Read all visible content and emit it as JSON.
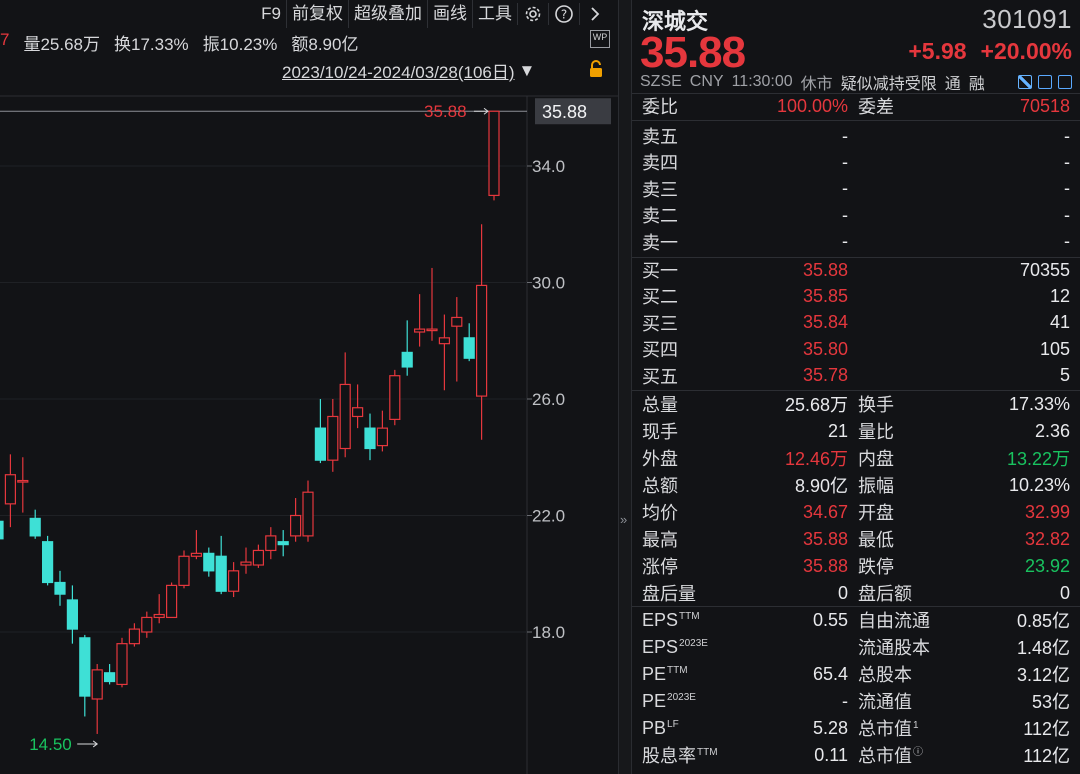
{
  "toolbar": {
    "items": [
      "F9",
      "前复权",
      "超级叠加",
      "画线",
      "工具"
    ],
    "icons": [
      "gear-icon",
      "help-icon",
      "chevron-right-icon"
    ]
  },
  "stats": {
    "cut_value": "7",
    "volume": "量25.68万",
    "turnover": "换17.33%",
    "amplitude": "振10.23%",
    "amount": "额8.90亿"
  },
  "wp_label": "WP",
  "range": {
    "text": "2023/10/24-2024/03/28(106日)",
    "arrow": "▼"
  },
  "chart_data": {
    "type": "candlestick",
    "y_ticks": [
      "34.0",
      "30.0",
      "26.0",
      "22.0",
      "18.0"
    ],
    "ylim": [
      14.0,
      36.0
    ],
    "current_price_label": "35.88",
    "high_annotation": "35.88",
    "low_annotation": "14.50",
    "up_color": "#e5373d",
    "down_color": "#3ee0d6",
    "candles": [
      {
        "o": 21.8,
        "c": 21.2,
        "h": 23.8,
        "l": 20.0
      },
      {
        "o": 22.4,
        "c": 23.4,
        "h": 24.1,
        "l": 21.6
      },
      {
        "o": 23.2,
        "c": 23.2,
        "h": 24.0,
        "l": 22.1
      },
      {
        "o": 21.9,
        "c": 21.3,
        "h": 22.2,
        "l": 21.2
      },
      {
        "o": 21.1,
        "c": 19.7,
        "h": 21.3,
        "l": 19.6
      },
      {
        "o": 19.7,
        "c": 19.3,
        "h": 20.1,
        "l": 18.9
      },
      {
        "o": 19.1,
        "c": 18.1,
        "h": 19.6,
        "l": 17.6
      },
      {
        "o": 17.8,
        "c": 15.8,
        "h": 17.9,
        "l": 15.1
      },
      {
        "o": 15.7,
        "c": 16.7,
        "h": 16.9,
        "l": 14.5
      },
      {
        "o": 16.6,
        "c": 16.3,
        "h": 16.9,
        "l": 16.2
      },
      {
        "o": 16.2,
        "c": 17.6,
        "h": 17.8,
        "l": 16.1
      },
      {
        "o": 17.6,
        "c": 18.1,
        "h": 18.3,
        "l": 17.5
      },
      {
        "o": 18.0,
        "c": 18.5,
        "h": 18.7,
        "l": 17.8
      },
      {
        "o": 18.5,
        "c": 18.6,
        "h": 19.3,
        "l": 18.3
      },
      {
        "o": 18.5,
        "c": 19.6,
        "h": 19.7,
        "l": 18.5
      },
      {
        "o": 19.6,
        "c": 20.6,
        "h": 20.8,
        "l": 19.5
      },
      {
        "o": 20.6,
        "c": 20.7,
        "h": 21.5,
        "l": 20.5
      },
      {
        "o": 20.7,
        "c": 20.1,
        "h": 20.9,
        "l": 19.9
      },
      {
        "o": 20.6,
        "c": 19.4,
        "h": 21.3,
        "l": 19.3
      },
      {
        "o": 19.4,
        "c": 20.1,
        "h": 20.4,
        "l": 19.2
      },
      {
        "o": 20.3,
        "c": 20.4,
        "h": 20.9,
        "l": 20.0
      },
      {
        "o": 20.3,
        "c": 20.8,
        "h": 21.0,
        "l": 20.2
      },
      {
        "o": 20.8,
        "c": 21.3,
        "h": 21.6,
        "l": 20.5
      },
      {
        "o": 21.1,
        "c": 21.0,
        "h": 21.5,
        "l": 20.6
      },
      {
        "o": 21.3,
        "c": 22.0,
        "h": 22.6,
        "l": 21.1
      },
      {
        "o": 21.3,
        "c": 22.8,
        "h": 23.2,
        "l": 21.1
      },
      {
        "o": 25.0,
        "c": 23.9,
        "h": 26.0,
        "l": 23.8
      },
      {
        "o": 23.9,
        "c": 25.4,
        "h": 26.0,
        "l": 23.5
      },
      {
        "o": 24.3,
        "c": 26.5,
        "h": 27.6,
        "l": 24.0
      },
      {
        "o": 25.4,
        "c": 25.7,
        "h": 26.5,
        "l": 25.0
      },
      {
        "o": 25.0,
        "c": 24.3,
        "h": 25.5,
        "l": 23.9
      },
      {
        "o": 24.4,
        "c": 25.0,
        "h": 25.6,
        "l": 24.2
      },
      {
        "o": 25.3,
        "c": 26.8,
        "h": 27.0,
        "l": 25.1
      },
      {
        "o": 27.6,
        "c": 27.1,
        "h": 28.7,
        "l": 26.8
      },
      {
        "o": 28.3,
        "c": 28.4,
        "h": 29.6,
        "l": 27.8
      },
      {
        "o": 28.4,
        "c": 28.4,
        "h": 30.5,
        "l": 28.0
      },
      {
        "o": 27.9,
        "c": 28.1,
        "h": 28.9,
        "l": 26.3
      },
      {
        "o": 28.5,
        "c": 28.8,
        "h": 29.5,
        "l": 26.6
      },
      {
        "o": 28.1,
        "c": 27.4,
        "h": 28.6,
        "l": 27.3
      },
      {
        "o": 26.1,
        "c": 29.9,
        "h": 32.0,
        "l": 24.6
      },
      {
        "o": 32.99,
        "c": 35.88,
        "h": 35.88,
        "l": 32.82
      }
    ]
  },
  "quote": {
    "name": "深城交",
    "code": "301091",
    "price": "35.88",
    "change": "+5.98",
    "change_pct": "+20.00%",
    "market": "SZSE",
    "currency": "CNY",
    "time": "11:30:00",
    "status": "休市",
    "flags": "疑似减持受限",
    "tong": "通",
    "rong": "融",
    "weibi_label": "委比",
    "weibi": "100.00%",
    "weicha_label": "委差",
    "weicha": "70518",
    "asks": [
      {
        "label": "卖五",
        "price": "-",
        "vol": "-"
      },
      {
        "label": "卖四",
        "price": "-",
        "vol": "-"
      },
      {
        "label": "卖三",
        "price": "-",
        "vol": "-"
      },
      {
        "label": "卖二",
        "price": "-",
        "vol": "-"
      },
      {
        "label": "卖一",
        "price": "-",
        "vol": "-"
      }
    ],
    "bids": [
      {
        "label": "买一",
        "price": "35.88",
        "vol": "70355"
      },
      {
        "label": "买二",
        "price": "35.85",
        "vol": "12"
      },
      {
        "label": "买三",
        "price": "35.84",
        "vol": "41"
      },
      {
        "label": "买四",
        "price": "35.80",
        "vol": "105"
      },
      {
        "label": "买五",
        "price": "35.78",
        "vol": "5"
      }
    ],
    "stats": [
      {
        "l1": "总量",
        "v1": "25.68万",
        "c1": "white",
        "l2": "换手",
        "v2": "17.33%",
        "c2": "white"
      },
      {
        "l1": "现手",
        "v1": "21",
        "c1": "white",
        "l2": "量比",
        "v2": "2.36",
        "c2": "white"
      },
      {
        "l1": "外盘",
        "v1": "12.46万",
        "c1": "red",
        "l2": "内盘",
        "v2": "13.22万",
        "c2": "green"
      },
      {
        "l1": "总额",
        "v1": "8.90亿",
        "c1": "white",
        "l2": "振幅",
        "v2": "10.23%",
        "c2": "white"
      },
      {
        "l1": "均价",
        "v1": "34.67",
        "c1": "red",
        "l2": "开盘",
        "v2": "32.99",
        "c2": "red"
      },
      {
        "l1": "最高",
        "v1": "35.88",
        "c1": "red",
        "l2": "最低",
        "v2": "32.82",
        "c2": "red"
      },
      {
        "l1": "涨停",
        "v1": "35.88",
        "c1": "red",
        "l2": "跌停",
        "v2": "23.92",
        "c2": "green"
      },
      {
        "l1": "盘后量",
        "v1": "0",
        "c1": "white",
        "l2": "盘后额",
        "v2": "0",
        "c2": "white"
      }
    ],
    "fundamentals": [
      {
        "l1": "EPS",
        "s1": "TTM",
        "v1": "0.55",
        "l2": "自由流通",
        "s2": "",
        "v2": "0.85亿"
      },
      {
        "l1": "EPS",
        "s1": "2023E",
        "v1": "",
        "l2": "流通股本",
        "s2": "",
        "v2": "1.48亿"
      },
      {
        "l1": "PE",
        "s1": "TTM",
        "v1": "65.4",
        "l2": "总股本",
        "s2": "",
        "v2": "3.12亿"
      },
      {
        "l1": "PE",
        "s1": "2023E",
        "v1": "-",
        "l2": "流通值",
        "s2": "",
        "v2": "53亿"
      },
      {
        "l1": "PB",
        "s1": "LF",
        "v1": "5.28",
        "l2": "总市值",
        "s2": "1",
        "v2": "112亿"
      },
      {
        "l1": "股息率",
        "s1": "TTM",
        "v1": "0.11",
        "l2": "总市值",
        "s2": "ⓘ",
        "v2": "112亿"
      }
    ]
  },
  "divider_label": "»"
}
